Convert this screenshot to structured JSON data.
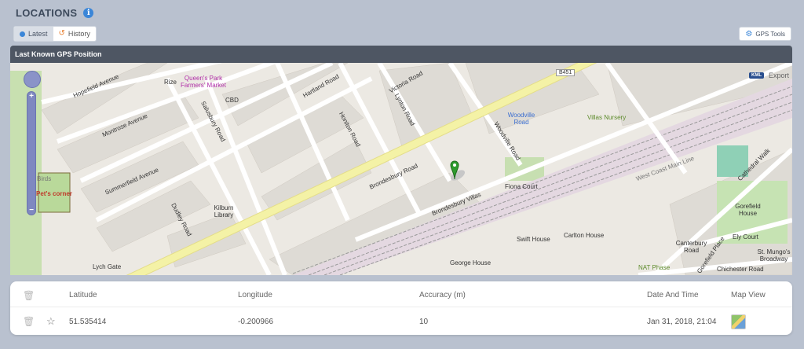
{
  "header": {
    "title": "LOCATIONS",
    "info_icon": "info-icon"
  },
  "toolbar": {
    "latest_label": "Latest",
    "history_label": "History",
    "gps_tools_label": "GPS Tools"
  },
  "panel": {
    "title": "Last Known GPS Position"
  },
  "map": {
    "export_label": "Export",
    "kml_badge": "KML",
    "labels": {
      "hopefield": "Hopefield Avenue",
      "montrose": "Montrose Avenue",
      "summerfield": "Summerfield Avenue",
      "dudley": "Dudley Road",
      "salusbury": "Salusbury Road",
      "hartland": "Hartland Road",
      "honiton": "Honiton Road",
      "lynton": "Lynton Road",
      "victoria": "Victoria Road",
      "woodville": "Woodville Road",
      "brondesbury_road": "Brondesbury Road",
      "brondesbury_villas": "Brondesbury Villas",
      "queens_park_market": "Queen's Park Farmers' Market",
      "rize": "Rize",
      "cbd": "CBD",
      "kilburn_library": "Kilburn Library",
      "woodville_stop": "Woodville Road",
      "villas_nursery": "Villas Nursery",
      "b451": "B451",
      "fiona_court": "Fiona Court",
      "west_coast_main_line": "West Coast Main Line",
      "cathedral_walk": "Cathedral Walk",
      "gorefield_house": "Gorefield House",
      "ely_court": "Ely Court",
      "st_mungos": "St. Mungo's Broadway",
      "canterbury_road": "Canterbury Road",
      "chichester_road": "Chichester Road",
      "nat_phase": "NAT Phase",
      "swift_house": "Swift House",
      "carlton_house": "Carlton House",
      "george_house": "George House",
      "pets_corner": "Pet's corner",
      "lych_gate": "Lych Gate",
      "gorefield_place": "Gorefield Place",
      "birds": "Birds"
    }
  },
  "table": {
    "columns": {
      "latitude": "Latitude",
      "longitude": "Longitude",
      "accuracy": "Accuracy (m)",
      "date": "Date And Time",
      "map_view": "Map View"
    },
    "rows": [
      {
        "latitude": "51.535414",
        "longitude": "-0.200966",
        "accuracy": "10",
        "date": "Jan 31, 2018, 21:04"
      }
    ]
  },
  "colors": {
    "background": "#b9c1cf",
    "panel_bar": "#4e5663",
    "accent": "#3b86d8",
    "history_accent": "#e87e2e",
    "road_yellow": "#f4f2a6",
    "marker_green": "#2e9b2e"
  }
}
